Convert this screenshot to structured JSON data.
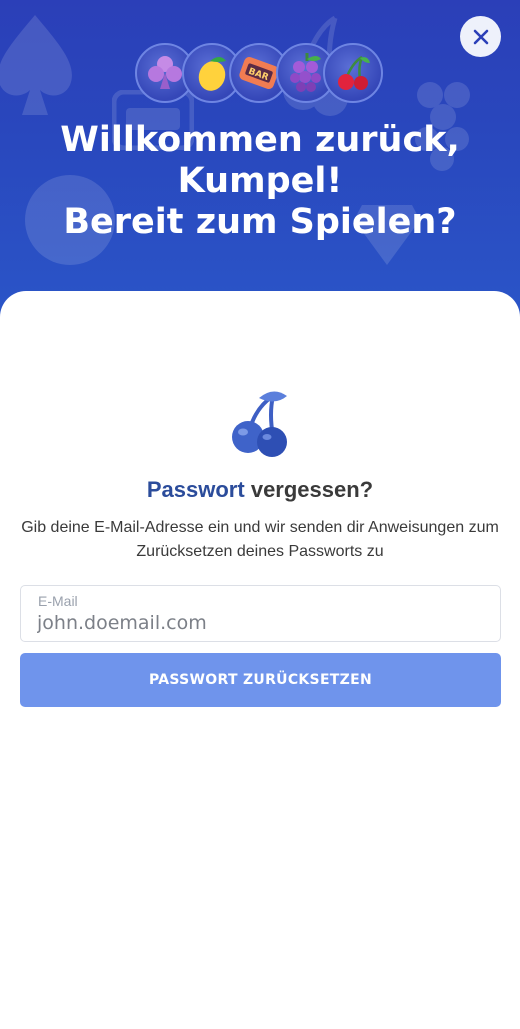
{
  "header": {
    "title_line1": "Willkommen zurück,",
    "title_line2": "Kumpel!",
    "title_line3": "Bereit zum Spielen?",
    "close_icon": "close-icon",
    "symbols": [
      "club-icon",
      "lemon-icon",
      "bar-icon",
      "grapes-icon",
      "cherry-icon"
    ],
    "background_color": "#2b47bd"
  },
  "forgot_password": {
    "icon": "cherry-icon",
    "title_accent": "Passwort",
    "title_rest": "vergessen?",
    "description": "Gib deine E-Mail-Adresse ein und wir senden dir Anweisungen zum Zurücksetzen deines Passworts zu",
    "email_label": "E-Mail",
    "email_placeholder": "john.doemail.com",
    "submit_label": "PASSWORT ZURÜCKSETZEN",
    "accent_color": "#2b4c9b",
    "button_color": "#6f94ec"
  }
}
